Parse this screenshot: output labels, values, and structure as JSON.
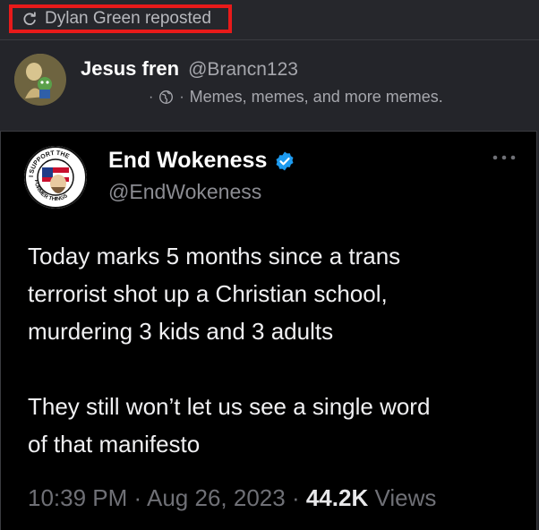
{
  "repost": {
    "label": "Dylan Green reposted",
    "highlight_color": "#e81a1a"
  },
  "post": {
    "author_name": "Jesus fren",
    "author_handle": "@Brancn123",
    "bio": "Memes, memes, and more memes.",
    "separator": "·"
  },
  "quote": {
    "author_name": "End Wokeness",
    "author_handle": "@EndWokeness",
    "verified": true,
    "text": "Today marks 5 months since a trans\nterrorist shot up a Christian school,\nmurdering 3 kids and 3 adults\n\nThey still won’t let us see a single word\nof that manifesto",
    "time": "10:39 PM",
    "date": "Aug 26, 2023",
    "views_count": "44.2K",
    "views_label": "Views",
    "separator": "·",
    "avatar_ring_text_top": "I SUPPORT THE",
    "avatar_ring_text_bottom": "FORMER THINGS"
  },
  "colors": {
    "verified_blue": "#1d9bf0",
    "card_bg": "#000000",
    "page_bg": "#24252a"
  }
}
